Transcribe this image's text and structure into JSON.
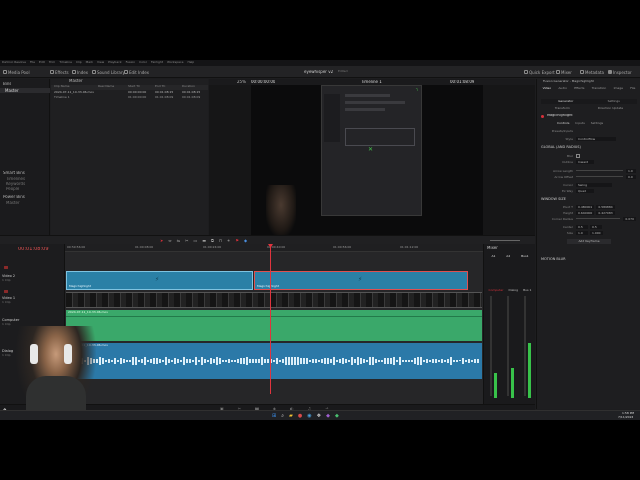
{
  "app": {
    "name": "DaVinci Resolve",
    "project_title": "eyewhisper v2",
    "project_status": "Edited",
    "timeline_name": "Timeline 1",
    "timecode_main": "00:01:08:09",
    "viewer_tc_left": "00:00:00:00",
    "viewer_tc_right": "00:01:08:09",
    "zoom": "25%"
  },
  "menu": [
    "DaVinci Resolve",
    "File",
    "Edit",
    "Trim",
    "Timeline",
    "Clip",
    "Mark",
    "View",
    "Playback",
    "Fusion",
    "Color",
    "Fairlight",
    "Workspace",
    "Help"
  ],
  "toolbar": {
    "media_pool": "Media Pool",
    "effects": "Effects",
    "index": "Index",
    "sound_library": "Sound Library",
    "edit_index": "Edit Index",
    "quick_export": "Quick Export",
    "mixer": "Mixer",
    "metadata": "Metadata",
    "inspector": "Inspector"
  },
  "bins": {
    "header": "Bins",
    "items": [
      "Master"
    ],
    "smart_bins_header": "Smart Bins",
    "smart_bins": [
      "Timelines",
      "Keywords",
      "People"
    ],
    "power_bins_header": "Power Bins",
    "power_bins": [
      "Master"
    ]
  },
  "clips": {
    "header": "Master",
    "columns": [
      "Clip Name",
      "Reel Name",
      "Start TC",
      "End TC",
      "Duration"
    ],
    "rows": [
      {
        "name": "2024-07-11_10-33-06.mov",
        "start": "00:00:00:00",
        "end": "00:01:08:15",
        "dur": "00:01:08:15"
      },
      {
        "name": "Timeline 1",
        "start": "01:00:00:00",
        "end": "01:01:08:09",
        "dur": "00:01:08:09"
      }
    ]
  },
  "timeline": {
    "tracks": [
      {
        "id": "V2",
        "name": "Video 2",
        "sub": "1 Clip"
      },
      {
        "id": "V1",
        "name": "Video 1",
        "sub": "1 Clip"
      },
      {
        "id": "A1",
        "name": "Computer",
        "sub": "1 Clip"
      },
      {
        "id": "A2",
        "name": "Dialog",
        "sub": "1 Clip"
      }
    ],
    "ruler_marks": [
      "00:59:56:00",
      "01:00:08:00",
      "01:00:24:00",
      "01:00:40:00",
      "01:00:56:00",
      "01:01:12:00"
    ],
    "clip_v2_a": "Magichighlight",
    "clip_v2_b": "Magichighlight",
    "clip_a1": "2024-07-11_10-33-06.mov",
    "clip_a2": "2024-07-11_10-33-06.mov",
    "clip_a2_tail": "Dialog",
    "playhead_fraction": 0.49
  },
  "mixer": {
    "header": "Mixer",
    "channels": [
      "A1",
      "A2",
      "Bus1"
    ],
    "channel_names": [
      "Computer",
      "Dialog",
      "Bus 1"
    ],
    "meter_levels": [
      0.25,
      0.3,
      0.55
    ]
  },
  "inspector": {
    "generator_title": "Fusion Generator - Magichighlight",
    "tabs": [
      "Video",
      "Audio",
      "Effects",
      "Transition",
      "Image",
      "File"
    ],
    "subtabs": [
      "Generator",
      "Settings"
    ],
    "subtabs2": [
      "Transform",
      "Direction Update"
    ],
    "effect_name": "Magichighlight",
    "control_tabs": [
      "Controls",
      "Inputs",
      "Settings"
    ],
    "presets_label": "Presets/Inputs",
    "style_label": "Style",
    "style_value": "Controlflow",
    "global_section": "GLOBAL (AND RADIUS)",
    "outline_label": "Outline",
    "outline_value": "Inward",
    "blur_label": "Blur",
    "arrow_length_label": "Arrow Length",
    "arrow_length_value": "1.0",
    "arrow_offset_label": "Arrow Offset",
    "arrow_offset_value": "0.0",
    "cursor_label": "Cursor",
    "cursor_value": "Swing",
    "ex_way_label": "Ex Way",
    "ex_way_value": "Quad",
    "window_section": "WINDOW SIZE",
    "pivot_label": "Pivot T",
    "pivot_x": "0.480001",
    "pivot_y": "0.589884",
    "height_label": "Height",
    "height_x": "0.640000",
    "height_y": "0.427083",
    "corner_radius_label": "Corner Radius",
    "corner_radius_value": "0.070",
    "center_label": "Center",
    "center_x": "0.5",
    "center_y": "0.5",
    "size_label": "Size",
    "size_x": "1.0",
    "size_y": "1.000",
    "add_button": "Add Keyframe",
    "motion_blur_section": "MOTION BLUR"
  },
  "page_nav": [
    "Media",
    "Cut",
    "Edit",
    "Fusion",
    "Color",
    "Fairlight",
    "Deliver"
  ],
  "taskbar": {
    "time": "1:58 PM",
    "date": "7/11/2024"
  },
  "colors": {
    "video_clip": "#2a80a6",
    "audio_green": "#3aa86a",
    "audio_blue": "#2b79a8",
    "playhead": "#e0343e",
    "accent_red": "#d8303a"
  }
}
